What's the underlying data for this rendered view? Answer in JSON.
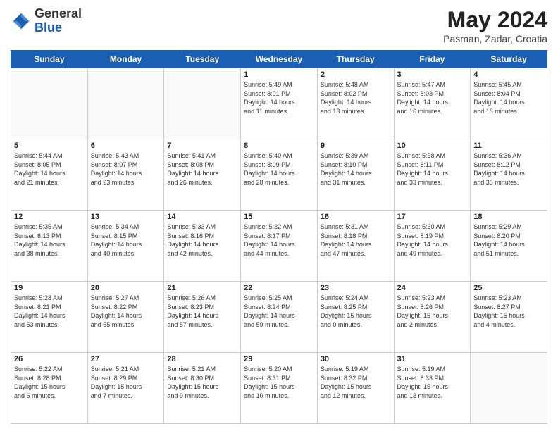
{
  "header": {
    "logo": {
      "general": "General",
      "blue": "Blue"
    },
    "title": "May 2024",
    "location": "Pasman, Zadar, Croatia"
  },
  "weekdays": [
    "Sunday",
    "Monday",
    "Tuesday",
    "Wednesday",
    "Thursday",
    "Friday",
    "Saturday"
  ],
  "weeks": [
    [
      {
        "day": "",
        "info": ""
      },
      {
        "day": "",
        "info": ""
      },
      {
        "day": "",
        "info": ""
      },
      {
        "day": "1",
        "info": "Sunrise: 5:49 AM\nSunset: 8:01 PM\nDaylight: 14 hours\nand 11 minutes."
      },
      {
        "day": "2",
        "info": "Sunrise: 5:48 AM\nSunset: 8:02 PM\nDaylight: 14 hours\nand 13 minutes."
      },
      {
        "day": "3",
        "info": "Sunrise: 5:47 AM\nSunset: 8:03 PM\nDaylight: 14 hours\nand 16 minutes."
      },
      {
        "day": "4",
        "info": "Sunrise: 5:45 AM\nSunset: 8:04 PM\nDaylight: 14 hours\nand 18 minutes."
      }
    ],
    [
      {
        "day": "5",
        "info": "Sunrise: 5:44 AM\nSunset: 8:05 PM\nDaylight: 14 hours\nand 21 minutes."
      },
      {
        "day": "6",
        "info": "Sunrise: 5:43 AM\nSunset: 8:07 PM\nDaylight: 14 hours\nand 23 minutes."
      },
      {
        "day": "7",
        "info": "Sunrise: 5:41 AM\nSunset: 8:08 PM\nDaylight: 14 hours\nand 26 minutes."
      },
      {
        "day": "8",
        "info": "Sunrise: 5:40 AM\nSunset: 8:09 PM\nDaylight: 14 hours\nand 28 minutes."
      },
      {
        "day": "9",
        "info": "Sunrise: 5:39 AM\nSunset: 8:10 PM\nDaylight: 14 hours\nand 31 minutes."
      },
      {
        "day": "10",
        "info": "Sunrise: 5:38 AM\nSunset: 8:11 PM\nDaylight: 14 hours\nand 33 minutes."
      },
      {
        "day": "11",
        "info": "Sunrise: 5:36 AM\nSunset: 8:12 PM\nDaylight: 14 hours\nand 35 minutes."
      }
    ],
    [
      {
        "day": "12",
        "info": "Sunrise: 5:35 AM\nSunset: 8:13 PM\nDaylight: 14 hours\nand 38 minutes."
      },
      {
        "day": "13",
        "info": "Sunrise: 5:34 AM\nSunset: 8:15 PM\nDaylight: 14 hours\nand 40 minutes."
      },
      {
        "day": "14",
        "info": "Sunrise: 5:33 AM\nSunset: 8:16 PM\nDaylight: 14 hours\nand 42 minutes."
      },
      {
        "day": "15",
        "info": "Sunrise: 5:32 AM\nSunset: 8:17 PM\nDaylight: 14 hours\nand 44 minutes."
      },
      {
        "day": "16",
        "info": "Sunrise: 5:31 AM\nSunset: 8:18 PM\nDaylight: 14 hours\nand 47 minutes."
      },
      {
        "day": "17",
        "info": "Sunrise: 5:30 AM\nSunset: 8:19 PM\nDaylight: 14 hours\nand 49 minutes."
      },
      {
        "day": "18",
        "info": "Sunrise: 5:29 AM\nSunset: 8:20 PM\nDaylight: 14 hours\nand 51 minutes."
      }
    ],
    [
      {
        "day": "19",
        "info": "Sunrise: 5:28 AM\nSunset: 8:21 PM\nDaylight: 14 hours\nand 53 minutes."
      },
      {
        "day": "20",
        "info": "Sunrise: 5:27 AM\nSunset: 8:22 PM\nDaylight: 14 hours\nand 55 minutes."
      },
      {
        "day": "21",
        "info": "Sunrise: 5:26 AM\nSunset: 8:23 PM\nDaylight: 14 hours\nand 57 minutes."
      },
      {
        "day": "22",
        "info": "Sunrise: 5:25 AM\nSunset: 8:24 PM\nDaylight: 14 hours\nand 59 minutes."
      },
      {
        "day": "23",
        "info": "Sunrise: 5:24 AM\nSunset: 8:25 PM\nDaylight: 15 hours\nand 0 minutes."
      },
      {
        "day": "24",
        "info": "Sunrise: 5:23 AM\nSunset: 8:26 PM\nDaylight: 15 hours\nand 2 minutes."
      },
      {
        "day": "25",
        "info": "Sunrise: 5:23 AM\nSunset: 8:27 PM\nDaylight: 15 hours\nand 4 minutes."
      }
    ],
    [
      {
        "day": "26",
        "info": "Sunrise: 5:22 AM\nSunset: 8:28 PM\nDaylight: 15 hours\nand 6 minutes."
      },
      {
        "day": "27",
        "info": "Sunrise: 5:21 AM\nSunset: 8:29 PM\nDaylight: 15 hours\nand 7 minutes."
      },
      {
        "day": "28",
        "info": "Sunrise: 5:21 AM\nSunset: 8:30 PM\nDaylight: 15 hours\nand 9 minutes."
      },
      {
        "day": "29",
        "info": "Sunrise: 5:20 AM\nSunset: 8:31 PM\nDaylight: 15 hours\nand 10 minutes."
      },
      {
        "day": "30",
        "info": "Sunrise: 5:19 AM\nSunset: 8:32 PM\nDaylight: 15 hours\nand 12 minutes."
      },
      {
        "day": "31",
        "info": "Sunrise: 5:19 AM\nSunset: 8:33 PM\nDaylight: 15 hours\nand 13 minutes."
      },
      {
        "day": "",
        "info": ""
      }
    ]
  ]
}
